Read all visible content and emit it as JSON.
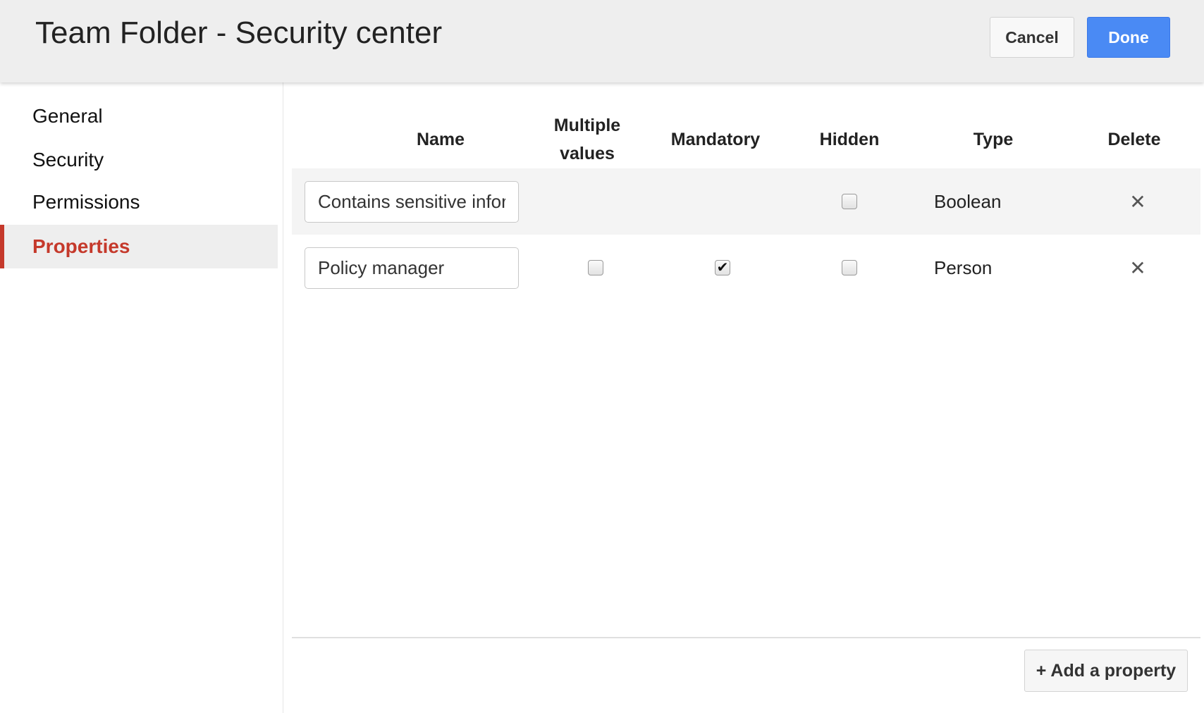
{
  "header": {
    "title": "Team Folder - Security center",
    "cancel_label": "Cancel",
    "done_label": "Done",
    "done_color": "#4a8af4"
  },
  "sidebar": {
    "accent_color": "#c5392b",
    "items": [
      {
        "label": "General",
        "active": false
      },
      {
        "label": "Security",
        "active": false
      },
      {
        "label": "Permissions",
        "active": false
      },
      {
        "label": "Properties",
        "active": true
      }
    ]
  },
  "table": {
    "columns": {
      "name": "Name",
      "multiple_line1": "Multiple",
      "multiple_line2": "values",
      "mandatory": "Mandatory",
      "hidden": "Hidden",
      "type": "Type",
      "delete": "Delete"
    },
    "rows": [
      {
        "name": "Contains sensitive infor",
        "multiple_values": null,
        "mandatory": null,
        "hidden": false,
        "type": "Boolean",
        "delete_icon": "close-icon"
      },
      {
        "name": "Policy manager",
        "multiple_values": false,
        "mandatory": true,
        "hidden": false,
        "type": "Person",
        "delete_icon": "close-icon"
      }
    ]
  },
  "footer": {
    "add_label": "+ Add a property"
  }
}
